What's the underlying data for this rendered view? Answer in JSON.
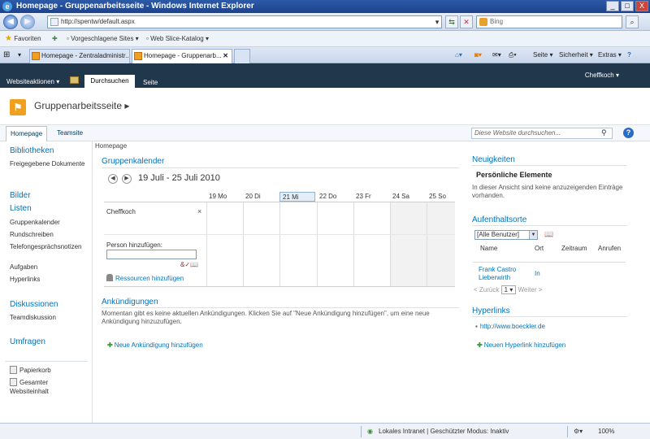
{
  "window": {
    "title": "Homepage - Gruppenarbeitsseite - Windows Internet Explorer",
    "controls": [
      "_",
      "□",
      "X"
    ]
  },
  "address": {
    "url": "http://spentw/default.aspx",
    "search_placeholder": "Bing"
  },
  "favorites": {
    "label": "Favoriten",
    "suggested": "Vorgeschlagene Sites ▾",
    "slice": "Web Slice-Katalog ▾"
  },
  "tabs": [
    {
      "label": "Homepage - Zentraladministr..."
    },
    {
      "label": "Homepage - Gruppenarb..."
    }
  ],
  "commandbar": {
    "page": "Seite ▾",
    "safety": "Sicherheit ▾",
    "extras": "Extras ▾",
    "help": "?"
  },
  "ribbon": {
    "site_actions": "Websiteaktionen ▾",
    "browse": "Durchsuchen",
    "page": "Seite",
    "user": "Cheffkoch ▾"
  },
  "site": {
    "title": "Gruppenarbeitsseite ▸"
  },
  "topnav": {
    "home": "Homepage",
    "teamsite": "Teamsite",
    "search_placeholder": "Diese Website durchsuchen..."
  },
  "leftnav": {
    "bibliotheken": "Bibliotheken",
    "freigegebene": "Freigegebene Dokumente",
    "bilder": "Bilder",
    "listen": "Listen",
    "list_items": [
      "Gruppenkalender",
      "Rundschreiben",
      "Telefongesprächsnotizen",
      "Aufgaben",
      "Hyperlinks"
    ],
    "diskussionen": "Diskussionen",
    "teamdiskussion": "Teamdiskussion",
    "umfragen": "Umfragen",
    "papierkorb": "Papierkorb",
    "gesamter": "Gesamter Websiteinhalt"
  },
  "breadcrumb": "Homepage",
  "calendar": {
    "title": "Gruppenkalender",
    "range": "19 Juli - 25 Juli 2010",
    "days": [
      "19 Mo",
      "20 Di",
      "21 Mi",
      "22 Do",
      "23 Fr",
      "24 Sa",
      "25 So"
    ],
    "today_index": 2,
    "person": "Cheffkoch",
    "remove": "×",
    "add_person_label": "Person hinzufügen:",
    "resources_link": "Ressourcen hinzufügen"
  },
  "announcements": {
    "title": "Ankündigungen",
    "text": "Momentan gibt es keine aktuellen Ankündigungen. Klicken Sie auf \"Neue Ankündigung hinzufügen\", um eine neue Ankündigung hinzuzufügen.",
    "add_link": "Neue Ankündigung hinzufügen"
  },
  "news": {
    "title": "Neuigkeiten",
    "personal": "Persönliche Elemente",
    "empty": "In dieser Ansicht sind keine anzuzeigenden Einträge vorhanden."
  },
  "whereabouts": {
    "title": "Aufenthaltsorte",
    "filter": "[Alle Benutzer]",
    "columns": [
      "Name",
      "Ort",
      "Zeitraum",
      "Anrufen"
    ],
    "row_name": "Frank Castro Lieberwirth",
    "row_place": "In",
    "prev": "< Zurück",
    "page": "1",
    "next": "Weiter >"
  },
  "hyperlinks": {
    "title": "Hyperlinks",
    "link": "http://www.boeckler.de",
    "add_link": "Neuen Hyperlink hinzufügen"
  },
  "status": {
    "zone": "Lokales Intranet | Geschützter Modus: Inaktiv",
    "zoom": "100%"
  }
}
